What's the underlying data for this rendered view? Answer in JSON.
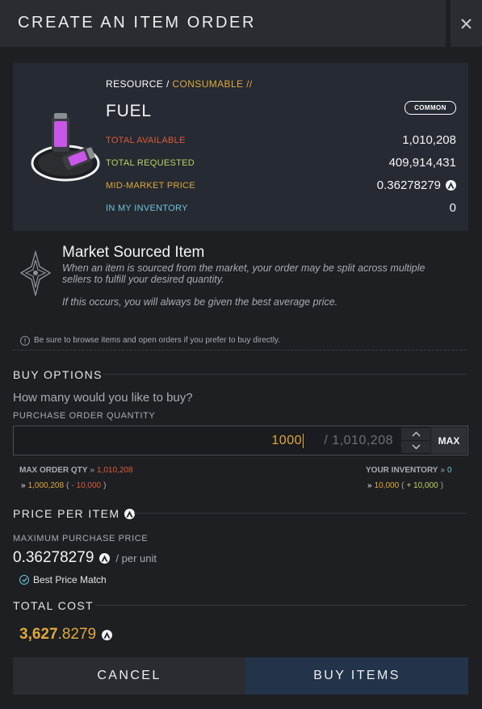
{
  "header": {
    "title": "CREATE AN ITEM ORDER",
    "close_icon": "close-icon"
  },
  "item": {
    "category_type": "RESOURCE /",
    "category_sub": "CONSUMABLE //",
    "name": "FUEL",
    "rarity": "COMMON",
    "stats": [
      {
        "label": "TOTAL AVAILABLE",
        "value": "1,010,208",
        "color": "#e05a3a"
      },
      {
        "label": "TOTAL REQUESTED",
        "value": "409,914,431",
        "color": "#b9d460"
      },
      {
        "label": "MID-MARKET PRICE",
        "value": "0.36278279",
        "color": "#e0a83a"
      },
      {
        "label": "IN MY INVENTORY",
        "value": "0",
        "color": "#6fc6d9"
      }
    ]
  },
  "market": {
    "title": "Market Sourced Item",
    "description": "When an item is sourced from the market, your order may be split across multiple sellers to fulfill your desired quantity.",
    "note": "If this occurs, you will always be given the best average price.",
    "tip": "Be sure to browse items and open orders if you prefer to buy directly."
  },
  "buy_options": {
    "heading": "BUY OPTIONS",
    "question": "How many would you like to buy?",
    "quantity_label": "PURCHASE ORDER QUANTITY",
    "quantity_value": "1000",
    "quantity_max": "/ 1,010,208",
    "max_button": "MAX",
    "max_order_label": "MAX ORDER QTY",
    "max_order_value": "1,010,208",
    "remaining_value": "1,000,208",
    "remaining_delta": "- 10,000",
    "inventory_label": "YOUR INVENTORY",
    "inventory_value": "0",
    "inventory_after": "10,000",
    "inventory_delta": "+ 10,000"
  },
  "price": {
    "heading": "PRICE PER ITEM",
    "max_label": "MAXIMUM PURCHASE PRICE",
    "value": "0.36278279",
    "unit": "/ per unit",
    "best_match": "Best Price Match"
  },
  "total": {
    "heading": "TOTAL COST",
    "value_main": "3,627",
    "value_decimal": ".8279"
  },
  "actions": {
    "cancel": "CANCEL",
    "buy": "BUY ITEMS"
  },
  "colors": {
    "accent_gold": "#e0a83a",
    "accent_teal": "#6fc6d9",
    "accent_red": "#e05a3a",
    "accent_green": "#b9d460",
    "buy_button": "#23344a"
  }
}
